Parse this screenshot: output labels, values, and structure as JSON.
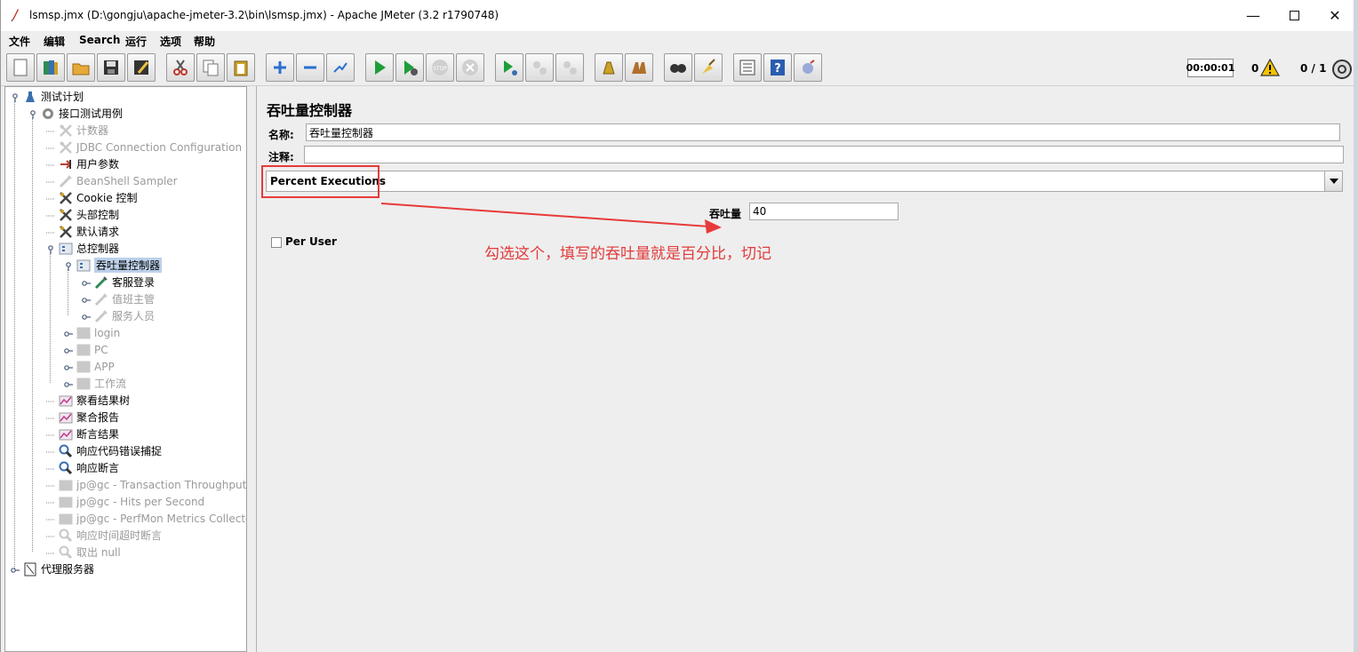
{
  "window": {
    "title": "lsmsp.jmx (D:\\gongju\\apache-jmeter-3.2\\bin\\lsmsp.jmx) - Apache JMeter (3.2 r1790748)",
    "controls": [
      "minimize",
      "maximize",
      "close"
    ]
  },
  "menu": {
    "items": [
      "文件",
      "编辑",
      "Search",
      "运行",
      "选项",
      "帮助"
    ]
  },
  "toolbar": {
    "buttons": [
      "new-icon",
      "templates-icon",
      "open-icon",
      "save-icon",
      "save-as-icon",
      "cut-icon",
      "copy-icon",
      "paste-icon",
      "expand-icon",
      "collapse-icon",
      "toggle-icon",
      "start-icon",
      "start-no-pause-icon",
      "stop-icon",
      "shutdown-icon",
      "remote-start-icon",
      "remote-stop-icon",
      "remote-shutdown-icon",
      "clear-icon",
      "clear-all-icon",
      "search-icon",
      "reset-search-icon",
      "function-helper-icon",
      "help-icon",
      "log-viewer-icon"
    ],
    "timer": "00:00:01",
    "warning_count": "0",
    "threads": "0 / 1"
  },
  "tree": {
    "items": [
      {
        "label": "测试计划",
        "enabled": true,
        "icon": "test-plan-icon"
      },
      {
        "label": "接口测试用例",
        "enabled": true,
        "icon": "thread-group-icon"
      },
      {
        "label": "计数器",
        "enabled": false,
        "icon": "config-icon"
      },
      {
        "label": "JDBC Connection Configuration",
        "enabled": false,
        "icon": "config-icon"
      },
      {
        "label": "用户参数",
        "enabled": true,
        "icon": "preprocessor-icon"
      },
      {
        "label": "BeanShell Sampler",
        "enabled": false,
        "icon": "sampler-icon"
      },
      {
        "label": "Cookie 控制",
        "enabled": true,
        "icon": "config-icon"
      },
      {
        "label": "头部控制",
        "enabled": true,
        "icon": "config-icon"
      },
      {
        "label": "默认请求",
        "enabled": true,
        "icon": "config-icon"
      },
      {
        "label": "总控制器",
        "enabled": true,
        "icon": "controller-icon"
      },
      {
        "label": "吞吐量控制器",
        "enabled": true,
        "icon": "controller-icon",
        "selected": true
      },
      {
        "label": "客服登录",
        "enabled": true,
        "icon": "sampler-icon"
      },
      {
        "label": "值班主管",
        "enabled": false,
        "icon": "sampler-icon"
      },
      {
        "label": "服务人员",
        "enabled": false,
        "icon": "sampler-icon"
      },
      {
        "label": "login",
        "enabled": false,
        "icon": "controller-icon"
      },
      {
        "label": "PC",
        "enabled": false,
        "icon": "controller-icon"
      },
      {
        "label": "APP",
        "enabled": false,
        "icon": "controller-icon"
      },
      {
        "label": "工作流",
        "enabled": false,
        "icon": "controller-icon"
      },
      {
        "label": "察看结果树",
        "enabled": true,
        "icon": "listener-icon"
      },
      {
        "label": "聚合报告",
        "enabled": true,
        "icon": "listener-icon"
      },
      {
        "label": "断言结果",
        "enabled": true,
        "icon": "listener-icon"
      },
      {
        "label": "响应代码错误捕捉",
        "enabled": true,
        "icon": "assertion-icon"
      },
      {
        "label": "响应断言",
        "enabled": true,
        "icon": "assertion-icon"
      },
      {
        "label": "jp@gc - Transaction Throughput vs",
        "enabled": false,
        "icon": "listener-icon"
      },
      {
        "label": "jp@gc - Hits per Second",
        "enabled": false,
        "icon": "listener-icon"
      },
      {
        "label": "jp@gc - PerfMon Metrics Collector",
        "enabled": false,
        "icon": "listener-icon"
      },
      {
        "label": "响应时间超时断言",
        "enabled": false,
        "icon": "assertion-icon"
      },
      {
        "label": "取出 null",
        "enabled": false,
        "icon": "assertion-icon"
      },
      {
        "label": "代理服务器",
        "enabled": true,
        "icon": "workbench-icon"
      }
    ]
  },
  "panel": {
    "title": "吞吐量控制器",
    "name_label": "名称:",
    "name_value": "吞吐量控制器",
    "comment_label": "注释:",
    "comment_value": "",
    "mode_selected": "Percent Executions",
    "throughput_label": "吞吐量",
    "throughput_value": "40",
    "per_user_label": "Per User",
    "per_user_checked": false
  },
  "annotation": {
    "text": "勾选这个，填写的吞吐量就是百分比，切记",
    "color": "#e23a3a"
  }
}
